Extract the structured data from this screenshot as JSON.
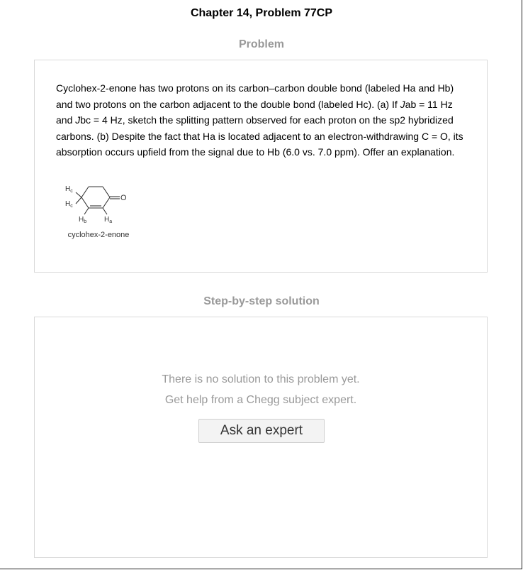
{
  "header": {
    "title": "Chapter 14, Problem 77CP"
  },
  "problem": {
    "section_label": "Problem",
    "text": {
      "p1": "Cyclohex-2-enone has two protons on its carbon–carbon double bond (labeled Ha and Hb) and two protons on the carbon adjacent to the double bond (labeled Hc). (a) If ",
      "j1": "J",
      "p2": "ab = 11 Hz and ",
      "j2": "J",
      "p3": "bc = 4 Hz, sketch the splitting pattern observed for each proton on the sp2 hybridized carbons. (b) Despite the fact that Ha is located adjacent to an electron-withdrawing C = O, its absorption occurs upfield from the signal due to Hb (6.0 vs. 7.0 ppm). Offer an explanation."
    },
    "figure": {
      "caption": "cyclohex-2-enone",
      "labels": {
        "hc": "H",
        "hc_sub": "c",
        "hb": "H",
        "hb_sub": "b",
        "ha": "H",
        "ha_sub": "a",
        "o": "O"
      }
    }
  },
  "solution": {
    "section_label": "Step-by-step solution",
    "empty_line1": "There is no solution to this problem yet.",
    "empty_line2": "Get help from a Chegg subject expert.",
    "button_label": "Ask an expert"
  }
}
